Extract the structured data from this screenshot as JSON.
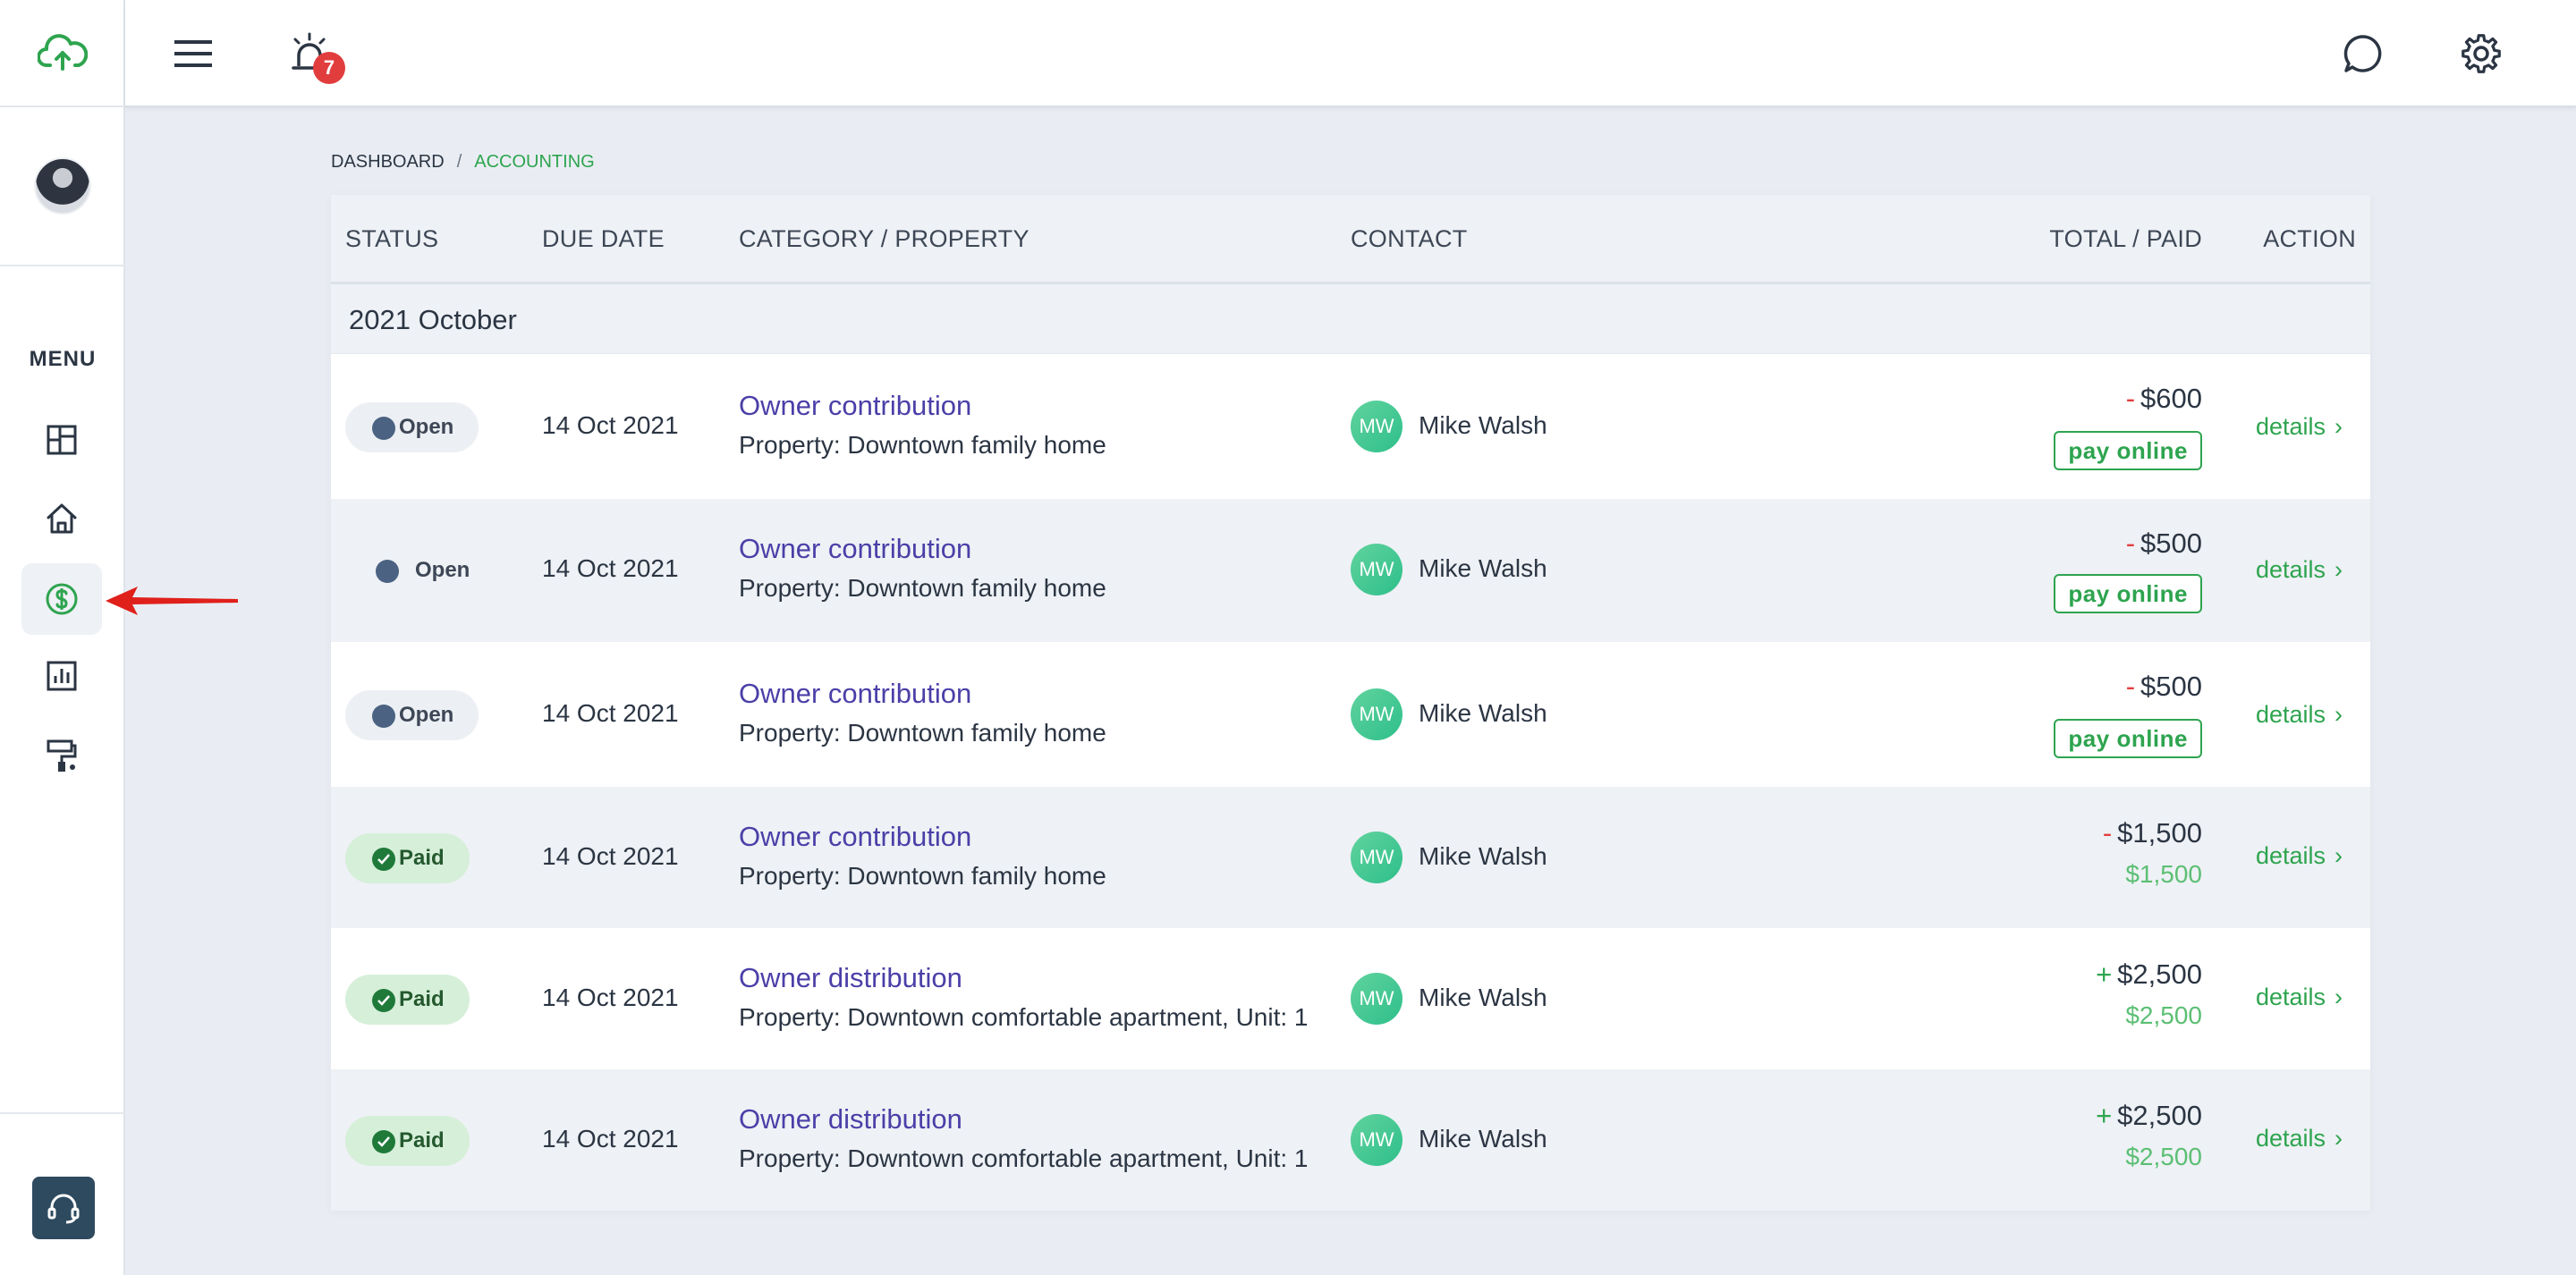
{
  "topbar": {
    "notification_count": "7",
    "icons": [
      "menu-icon",
      "alarm-bell-icon",
      "chat-bubble-icon",
      "gear-icon"
    ]
  },
  "sidebar": {
    "menu_label": "MENU",
    "items": [
      {
        "name": "dashboard",
        "icon": "dashboard-grid-icon"
      },
      {
        "name": "properties",
        "icon": "home-icon"
      },
      {
        "name": "accounting",
        "icon": "dollar-circle-icon",
        "active": true
      },
      {
        "name": "reports",
        "icon": "bar-chart-icon"
      },
      {
        "name": "maintenance",
        "icon": "paint-roller-icon"
      }
    ]
  },
  "breadcrumb": {
    "items": [
      "DASHBOARD",
      "ACCOUNTING"
    ],
    "separator": "/"
  },
  "table": {
    "columns": {
      "status": "STATUS",
      "due_date": "DUE DATE",
      "category": "CATEGORY / PROPERTY",
      "contact": "CONTACT",
      "total": "TOTAL / PAID",
      "action": "ACTION"
    },
    "group_title": "2021 October",
    "rows": [
      {
        "status": "Open",
        "due": "14 Oct 2021",
        "category": "Owner contribution",
        "property": "Property: Downtown family home",
        "contact_initials": "MW",
        "contact": "Mike Walsh",
        "sign": "-",
        "total": "$600",
        "pay_label": "pay online",
        "action": "details"
      },
      {
        "status": "Open",
        "due": "14 Oct 2021",
        "category": "Owner contribution",
        "property": "Property: Downtown family home",
        "contact_initials": "MW",
        "contact": "Mike Walsh",
        "sign": "-",
        "total": "$500",
        "pay_label": "pay online",
        "action": "details"
      },
      {
        "status": "Open",
        "due": "14 Oct 2021",
        "category": "Owner contribution",
        "property": "Property: Downtown family home",
        "contact_initials": "MW",
        "contact": "Mike Walsh",
        "sign": "-",
        "total": "$500",
        "pay_label": "pay online",
        "action": "details"
      },
      {
        "status": "Paid",
        "due": "14 Oct 2021",
        "category": "Owner contribution",
        "property": "Property: Downtown family home",
        "contact_initials": "MW",
        "contact": "Mike Walsh",
        "sign": "-",
        "total": "$1,500",
        "paid": "$1,500",
        "action": "details"
      },
      {
        "status": "Paid",
        "due": "14 Oct 2021",
        "category": "Owner distribution",
        "property": "Property: Downtown comfortable apartment, Unit: 1",
        "contact_initials": "MW",
        "contact": "Mike Walsh",
        "sign": "+",
        "total": "$2,500",
        "paid": "$2,500",
        "action": "details"
      },
      {
        "status": "Paid",
        "due": "14 Oct 2021",
        "category": "Owner distribution",
        "property": "Property: Downtown comfortable apartment, Unit: 1",
        "contact_initials": "MW",
        "contact": "Mike Walsh",
        "sign": "+",
        "total": "$2,500",
        "paid": "$2,500",
        "action": "details"
      }
    ]
  },
  "colors": {
    "brand_green": "#2ea44f",
    "link_purple": "#4b3fa8",
    "negative_red": "#e23d3d",
    "status_open_dot": "#4b6282",
    "annotation_arrow": "#e0201b"
  }
}
